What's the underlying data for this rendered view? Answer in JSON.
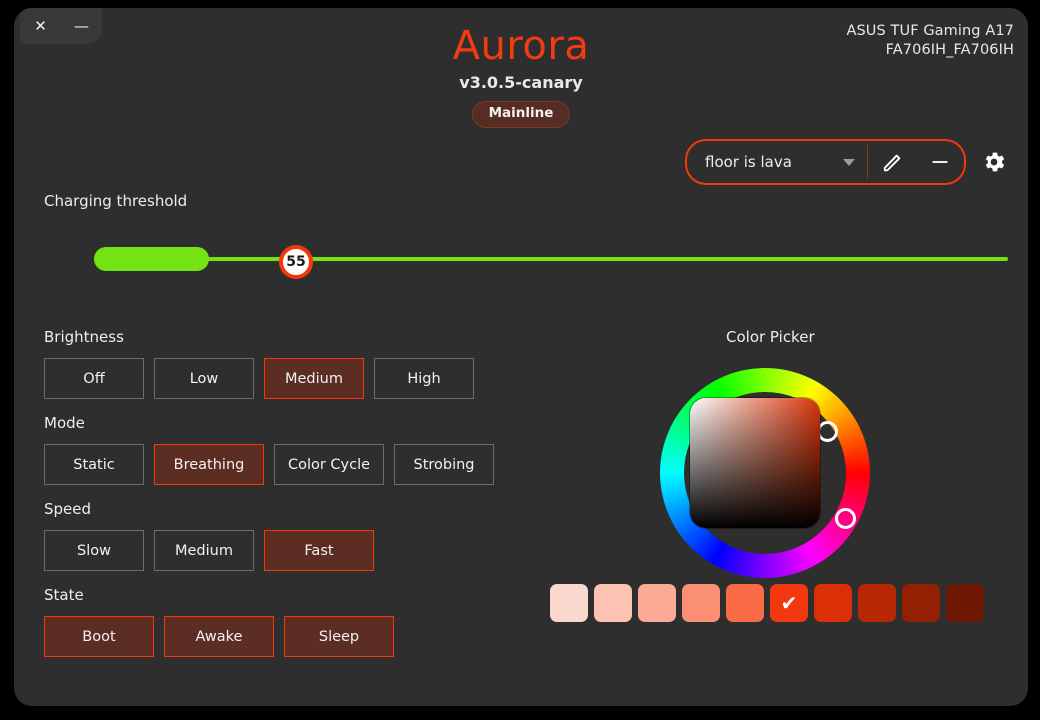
{
  "window": {
    "close_label": "✕",
    "minimize_label": "—"
  },
  "header": {
    "app_title": "Aurora",
    "version": "v3.0.5-canary",
    "branch_badge": "Mainline",
    "device_model": "ASUS TUF Gaming A17",
    "device_id": "FA706IH_FA706IH",
    "accent_color": "#f2380e",
    "title_color": "#f23a13"
  },
  "profile": {
    "selected": "floor is lava",
    "dropdown_icon": "chevron-down-icon",
    "edit_icon": "pencil-icon",
    "remove_icon": "minus-icon",
    "settings_icon": "gear-icon"
  },
  "charging": {
    "label": "Charging threshold",
    "value": "55",
    "min": 0,
    "max": 100,
    "track_color": "#74e312"
  },
  "brightness": {
    "label": "Brightness",
    "options": [
      {
        "label": "Off",
        "selected": false
      },
      {
        "label": "Low",
        "selected": false
      },
      {
        "label": "Medium",
        "selected": true
      },
      {
        "label": "High",
        "selected": false
      }
    ]
  },
  "mode": {
    "label": "Mode",
    "options": [
      {
        "label": "Static",
        "selected": false
      },
      {
        "label": "Breathing",
        "selected": true
      },
      {
        "label": "Color Cycle",
        "selected": false
      },
      {
        "label": "Strobing",
        "selected": false
      }
    ]
  },
  "speed": {
    "label": "Speed",
    "options": [
      {
        "label": "Slow",
        "selected": false
      },
      {
        "label": "Medium",
        "selected": false
      },
      {
        "label": "Fast",
        "selected": true
      }
    ]
  },
  "state": {
    "label": "State",
    "options": [
      {
        "label": "Boot",
        "selected": true
      },
      {
        "label": "Awake",
        "selected": true
      },
      {
        "label": "Sleep",
        "selected": true
      }
    ]
  },
  "color_picker": {
    "label": "Color Picker",
    "selected_color": "#f2380e",
    "check_glyph": "✔",
    "swatches": [
      {
        "color": "#fad8cd",
        "selected": false
      },
      {
        "color": "#fcc3b3",
        "selected": false
      },
      {
        "color": "#fbaa95",
        "selected": false
      },
      {
        "color": "#fa8f74",
        "selected": false
      },
      {
        "color": "#f96a46",
        "selected": false
      },
      {
        "color": "#f2380e",
        "selected": true
      },
      {
        "color": "#db2f07",
        "selected": false
      },
      {
        "color": "#b72704",
        "selected": false
      },
      {
        "color": "#942004",
        "selected": false
      },
      {
        "color": "#6e1803",
        "selected": false
      }
    ]
  }
}
